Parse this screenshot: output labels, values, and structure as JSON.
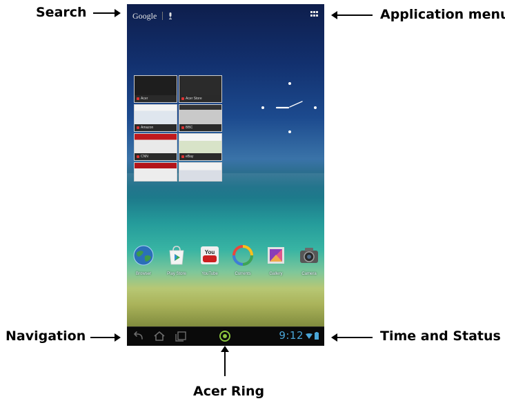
{
  "callouts": {
    "search": "Search",
    "app_menu": "Application menu",
    "navigation": "Navigation",
    "time_status": "Time and Status",
    "acer_ring": "Acer Ring"
  },
  "searchbar": {
    "logo_text": "Google",
    "mic_icon": "microphone-icon"
  },
  "app_menu_icon": "grid-icon",
  "browser_widget": {
    "tiles": [
      {
        "caption": "Acer"
      },
      {
        "caption": "Acer Store"
      },
      {
        "caption": "Amazon"
      },
      {
        "caption": "BBC"
      },
      {
        "caption": "CNN"
      },
      {
        "caption": "eBay"
      },
      {
        "caption": ""
      },
      {
        "caption": ""
      }
    ]
  },
  "dock": {
    "apps": [
      {
        "label": "Browser",
        "icon": "globe-icon"
      },
      {
        "label": "Play Store",
        "icon": "play-store-icon"
      },
      {
        "label": "YouTube",
        "icon": "youtube-icon"
      },
      {
        "label": "Currents",
        "icon": "currents-icon"
      },
      {
        "label": "Gallery",
        "icon": "gallery-icon"
      },
      {
        "label": "Camera",
        "icon": "camera-icon"
      }
    ],
    "youtube_logo_text": "You"
  },
  "status": {
    "time": "9:12"
  },
  "colors": {
    "status_accent": "#4aa6d8",
    "ring_accent": "#8cc63f"
  }
}
